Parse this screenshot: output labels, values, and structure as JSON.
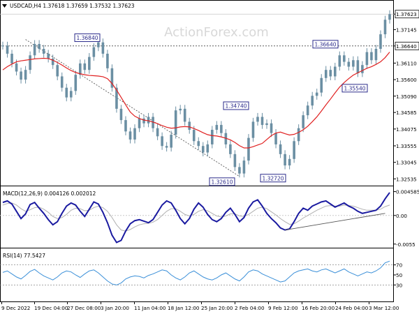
{
  "chart_data": [
    {
      "type": "candlestick",
      "panel": "price",
      "title": "USDCAD,H4  1.37618 1.37659 1.37532 1.37623",
      "watermark": "ActionForex.com",
      "ylim": [
        1.3237,
        1.378
      ],
      "yticks": [
        "1.37623",
        "1.37145",
        "1.36640",
        "1.36110",
        "1.35600",
        "1.35090",
        "1.34585",
        "1.34075",
        "1.33555",
        "1.33045",
        "1.32535"
      ],
      "y_values": [
        1.37623,
        1.37145,
        1.3664,
        1.3611,
        1.356,
        1.3509,
        1.34585,
        1.34075,
        1.33555,
        1.33045,
        1.32535
      ],
      "current_price": "1.37623",
      "horizontal_levels": [
        {
          "value": 1.3664,
          "label": "1.36640",
          "style": "dashed"
        }
      ],
      "close_series": [
        1.3665,
        1.364,
        1.361,
        1.3585,
        1.356,
        1.359,
        1.3635,
        1.367,
        1.3655,
        1.364,
        1.3625,
        1.3605,
        1.357,
        1.3535,
        1.3505,
        1.3525,
        1.3575,
        1.361,
        1.359,
        1.363,
        1.366,
        1.3675,
        1.364,
        1.3595,
        1.3535,
        1.347,
        1.3435,
        1.34,
        1.3375,
        1.341,
        1.344,
        1.3425,
        1.3445,
        1.341,
        1.3385,
        1.3355,
        1.335,
        1.339,
        1.3465,
        1.347,
        1.343,
        1.3405,
        1.337,
        1.3355,
        1.3335,
        1.336,
        1.3405,
        1.342,
        1.3395,
        1.336,
        1.333,
        1.329,
        1.327,
        1.331,
        1.338,
        1.343,
        1.3445,
        1.342,
        1.3425,
        1.3395,
        1.336,
        1.333,
        1.3295,
        1.3315,
        1.337,
        1.341,
        1.345,
        1.348,
        1.351,
        1.352,
        1.3565,
        1.359,
        1.357,
        1.36,
        1.3635,
        1.3615,
        1.36,
        1.362,
        1.358,
        1.3605,
        1.3645,
        1.362,
        1.3655,
        1.37,
        1.3745,
        1.3762
      ],
      "moving_average": [
        1.359,
        1.36,
        1.3608,
        1.3615,
        1.3618,
        1.362,
        1.3622,
        1.3624,
        1.3625,
        1.3626,
        1.3625,
        1.362,
        1.3613,
        1.3605,
        1.3596,
        1.3588,
        1.3582,
        1.3578,
        1.3575,
        1.3573,
        1.3572,
        1.3571,
        1.3569,
        1.3563,
        1.3548,
        1.3528,
        1.3505,
        1.3482,
        1.346,
        1.3447,
        1.344,
        1.3435,
        1.3433,
        1.3429,
        1.3424,
        1.3418,
        1.3413,
        1.341,
        1.3411,
        1.3414,
        1.3415,
        1.3414,
        1.3409,
        1.3403,
        1.3396,
        1.339,
        1.3387,
        1.3386,
        1.3383,
        1.3379,
        1.3374,
        1.3366,
        1.3356,
        1.3349,
        1.3349,
        1.3353,
        1.3358,
        1.3363,
        1.3375,
        1.3387,
        1.3395,
        1.3398,
        1.3393,
        1.3389,
        1.3391,
        1.3397,
        1.3405,
        1.3416,
        1.343,
        1.3445,
        1.3463,
        1.3482,
        1.35,
        1.3519,
        1.3537,
        1.3551,
        1.3563,
        1.3574,
        1.3581,
        1.3588,
        1.3595,
        1.36,
        1.3607,
        1.3615,
        1.3628,
        1.3645
      ],
      "trendline": {
        "from": [
          1.3684,
          1.3684
        ],
        "to": [
          1.3261,
          1.3261
        ]
      },
      "annotations": [
        {
          "text": "1.36840",
          "value": 1.3684
        },
        {
          "text": "1.34740",
          "value": 1.3474
        },
        {
          "text": "1.32610",
          "value": 1.3261
        },
        {
          "text": "1.32720",
          "value": 1.3272
        },
        {
          "text": "1.36640",
          "value": 1.3664
        },
        {
          "text": "1.35540",
          "value": 1.3554
        }
      ],
      "colors": {
        "candle": "#6b8fa3",
        "moving_average": "#e02020",
        "label_box": "#2a2a8a"
      }
    },
    {
      "type": "line",
      "panel": "macd",
      "title": "MACD(12,26,9) 0.004126 0.002012",
      "ylim": [
        -0.0058,
        0.0052
      ],
      "yticks": [
        "0.004585",
        "0.00",
        "-0.0055"
      ],
      "y_values": [
        0.004585,
        0.0,
        -0.0055
      ],
      "macd": [
        0.0025,
        0.0028,
        0.0022,
        0.0008,
        -0.0006,
        0.0003,
        0.0021,
        0.0025,
        0.0014,
        0.0004,
        -0.0008,
        -0.0018,
        -0.0012,
        0.0004,
        0.0018,
        0.0024,
        0.002,
        0.0008,
        -0.0002,
        0.0012,
        0.0026,
        0.0022,
        0.0006,
        -0.0014,
        -0.0038,
        -0.0052,
        -0.0048,
        -0.003,
        -0.0016,
        -0.001,
        -0.0008,
        -0.0011,
        -0.0014,
        -0.0008,
        0.0006,
        0.002,
        0.0028,
        0.0024,
        0.001,
        -0.0006,
        -0.0016,
        -0.0006,
        0.0012,
        0.0024,
        0.0016,
        0.0002,
        -0.0008,
        -0.0012,
        -0.0006,
        0.0006,
        0.0014,
        0.0002,
        -0.0012,
        -0.0004,
        0.0014,
        0.0026,
        0.003,
        0.0018,
        0.0004,
        -0.0006,
        -0.0014,
        -0.0024,
        -0.0028,
        -0.0026,
        -0.0012,
        0.0004,
        0.0014,
        0.001,
        0.0018,
        0.0022,
        0.0026,
        0.0028,
        0.0022,
        0.0016,
        0.002,
        0.0024,
        0.0018,
        0.0014,
        0.0008,
        0.0004,
        0.0006,
        0.0008,
        0.001,
        0.0018,
        0.0032,
        0.0044
      ],
      "signal": [
        0.002,
        0.0023,
        0.0024,
        0.002,
        0.0013,
        0.0008,
        0.0011,
        0.0015,
        0.0016,
        0.0012,
        0.0006,
        -0.0002,
        -0.0006,
        -0.0004,
        0.0002,
        0.001,
        0.0014,
        0.0013,
        0.0009,
        0.001,
        0.0015,
        0.0018,
        0.0015,
        0.0008,
        -0.0004,
        -0.0018,
        -0.0028,
        -0.003,
        -0.0027,
        -0.0022,
        -0.0018,
        -0.0016,
        -0.0015,
        -0.0013,
        -0.0008,
        0.0,
        0.0008,
        0.0013,
        0.0013,
        0.0008,
        0.0002,
        -0.0001,
        0.0002,
        0.0008,
        0.0011,
        0.0009,
        0.0004,
        -0.0001,
        -0.0003,
        -0.0001,
        0.0003,
        0.0003,
        -0.0001,
        -0.0002,
        0.0002,
        0.0008,
        0.0014,
        0.0016,
        0.0013,
        0.0007,
        0.0001,
        -0.0006,
        -0.0012,
        -0.0017,
        -0.0016,
        -0.0011,
        -0.0005,
        0.0,
        0.0005,
        0.001,
        0.0014,
        0.0018,
        0.0019,
        0.0018,
        0.0018,
        0.002,
        0.0019,
        0.0018,
        0.0015,
        0.0012,
        0.001,
        0.001,
        0.001,
        0.0012,
        0.0017,
        0.002
      ],
      "trendline": {
        "from": [
          0.0,
          0.0
        ],
        "to": [
          0.0004,
          0.0004
        ]
      },
      "colors": {
        "macd": "#1a1aa0",
        "signal": "#b0b0b0",
        "trendline": "#555555"
      }
    },
    {
      "type": "line",
      "panel": "rsi",
      "title": "RSI(14) 77.5427",
      "ylim": [
        0,
        100
      ],
      "yticks": [
        "70",
        "50",
        "30"
      ],
      "y_values": [
        70,
        50,
        30
      ],
      "values": [
        55,
        58,
        52,
        46,
        42,
        49,
        57,
        61,
        54,
        48,
        44,
        40,
        46,
        54,
        58,
        56,
        50,
        45,
        52,
        58,
        60,
        54,
        46,
        38,
        32,
        30,
        34,
        42,
        46,
        48,
        47,
        44,
        49,
        52,
        56,
        60,
        58,
        50,
        44,
        40,
        46,
        54,
        58,
        52,
        46,
        42,
        40,
        44,
        50,
        54,
        48,
        42,
        38,
        46,
        56,
        60,
        58,
        52,
        48,
        44,
        40,
        36,
        38,
        46,
        54,
        58,
        60,
        62,
        58,
        56,
        60,
        62,
        58,
        54,
        58,
        62,
        56,
        52,
        48,
        52,
        56,
        54,
        58,
        64,
        74,
        77.5
      ],
      "colors": {
        "line": "#3a8fd8",
        "levels": "#888888"
      }
    }
  ],
  "x_axis": {
    "tick_labels": [
      "9 Dec 2022",
      "19 Dec 04:00",
      "27 Dec 08:00",
      "3 Jan 20:00",
      "11 Jan 04:00",
      "18 Jan 12:00",
      "25 Jan 20:00",
      "2 Feb 04:00",
      "9 Feb 12:00",
      "16 Feb 20:00",
      "24 Feb 04:00",
      "3 Mar 12:00"
    ]
  }
}
